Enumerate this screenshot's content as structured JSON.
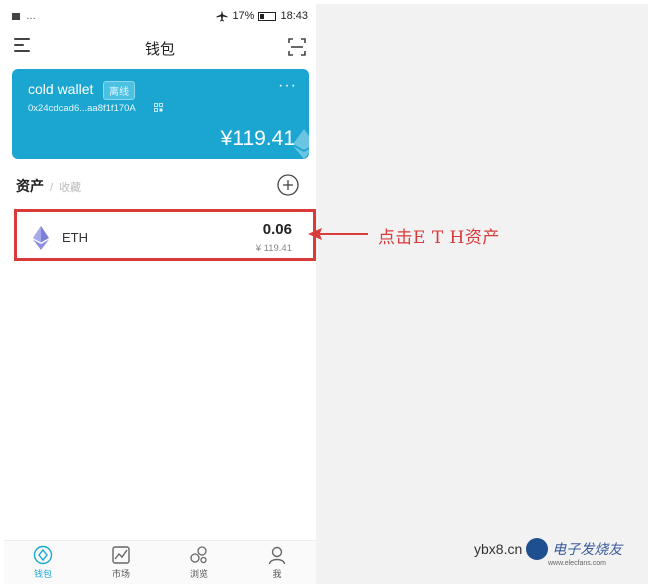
{
  "status_bar": {
    "left": "…",
    "battery": "17%",
    "time": "18:43"
  },
  "nav": {
    "title": "钱包"
  },
  "wallet_card": {
    "name": "cold wallet",
    "badge": "离线",
    "more": "···",
    "address": "0x24cdcad6...aa8f1f170A",
    "balance": "¥119.41",
    "color": "#1aa6d1"
  },
  "assets_section": {
    "title": "资产",
    "separator": "/",
    "tab": "收藏"
  },
  "assets": [
    {
      "name": "ETH",
      "amount": "0.06",
      "fiat": "¥ 119.41",
      "icon": "ethereum-icon"
    }
  ],
  "tabbar": [
    {
      "label": "钱包",
      "icon": "wallet-icon",
      "active": true
    },
    {
      "label": "市场",
      "icon": "market-chart-icon",
      "active": false
    },
    {
      "label": "浏览",
      "icon": "browse-icon",
      "active": false
    },
    {
      "label": "我",
      "icon": "profile-icon",
      "active": false
    }
  ],
  "annotation": {
    "text": "点击E T H资产",
    "color": "#d93a3a"
  },
  "watermark": {
    "left": "ybx8",
    "dot": ".",
    "cn": "cn",
    "brand": "电子发烧友",
    "sub": "www.elecfans.com"
  }
}
